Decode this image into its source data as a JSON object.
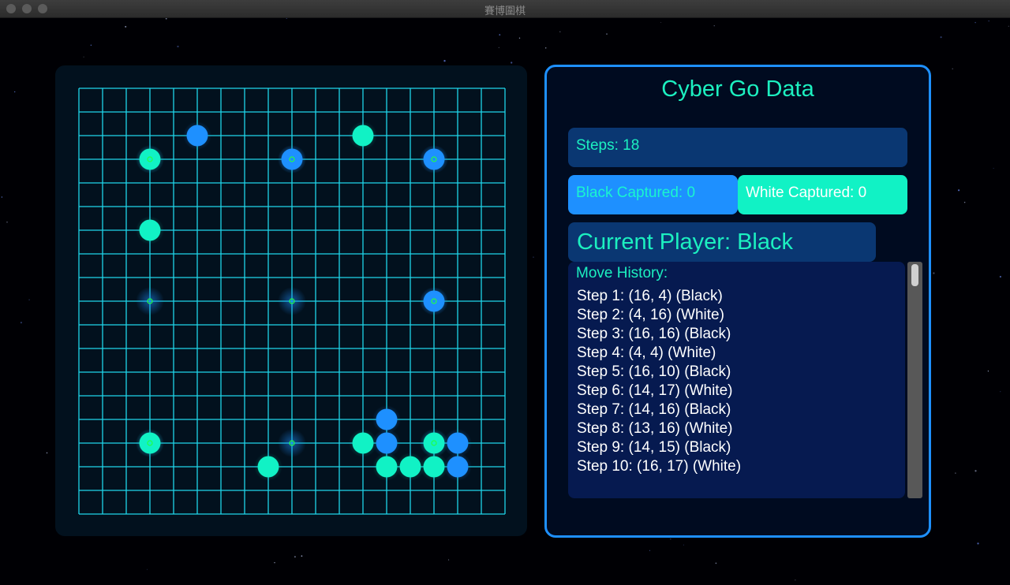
{
  "window": {
    "title": "賽博圍棋"
  },
  "colors": {
    "accent": "#1e90ff",
    "cyan": "#1cf0c0",
    "black_stone": "#1e90ff",
    "white_stone": "#11f2c5",
    "grid": "#1fd6ea",
    "star_point": "#22ff44"
  },
  "board": {
    "stones": [
      {
        "row": 2,
        "col": 5,
        "color": "black"
      },
      {
        "row": 2,
        "col": 12,
        "color": "white"
      },
      {
        "row": 3,
        "col": 3,
        "color": "white"
      },
      {
        "row": 3,
        "col": 9,
        "color": "black"
      },
      {
        "row": 3,
        "col": 15,
        "color": "black"
      },
      {
        "row": 6,
        "col": 3,
        "color": "white"
      },
      {
        "row": 9,
        "col": 15,
        "color": "black"
      },
      {
        "row": 14,
        "col": 13,
        "color": "black"
      },
      {
        "row": 15,
        "col": 3,
        "color": "white"
      },
      {
        "row": 15,
        "col": 12,
        "color": "white"
      },
      {
        "row": 15,
        "col": 13,
        "color": "black"
      },
      {
        "row": 15,
        "col": 15,
        "color": "white"
      },
      {
        "row": 15,
        "col": 16,
        "color": "black"
      },
      {
        "row": 16,
        "col": 8,
        "color": "white"
      },
      {
        "row": 16,
        "col": 13,
        "color": "white"
      },
      {
        "row": 16,
        "col": 14,
        "color": "white"
      },
      {
        "row": 16,
        "col": 15,
        "color": "white"
      },
      {
        "row": 16,
        "col": 16,
        "color": "black"
      }
    ]
  },
  "info": {
    "title": "Cyber Go Data",
    "steps_label": "Steps: 18",
    "black_captured": "Black Captured: 0",
    "white_captured": "White Captured: 0",
    "current_player": "Current Player: Black",
    "history_title": "Move History:",
    "history": [
      "Step 1: (16, 4) (Black)",
      "Step 2: (4, 16) (White)",
      "Step 3: (16, 16) (Black)",
      "Step 4: (4, 4) (White)",
      "Step 5: (16, 10) (Black)",
      "Step 6: (14, 17) (White)",
      "Step 7: (14, 16) (Black)",
      "Step 8: (13, 16) (White)",
      "Step 9: (14, 15) (Black)",
      "Step 10: (16, 17) (White)"
    ]
  }
}
